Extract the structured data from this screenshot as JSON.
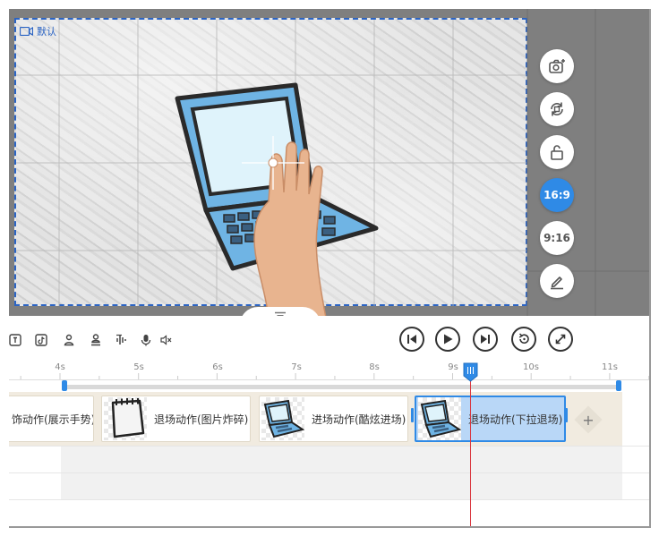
{
  "stage": {
    "scene_label": "默认",
    "aspect_options": [
      "16:9",
      "9:16"
    ],
    "active_aspect": "16:9",
    "tools": [
      {
        "name": "screenshot",
        "icon": "camera-plus-icon"
      },
      {
        "name": "rotate",
        "icon": "rotate-icon"
      },
      {
        "name": "lock",
        "icon": "unlock-icon"
      },
      {
        "name": "ratio-16-9",
        "label": "16:9"
      },
      {
        "name": "ratio-9-16",
        "label": "9:16"
      },
      {
        "name": "edit",
        "icon": "pencil-icon"
      }
    ],
    "accent_color": "#2f8ae6"
  },
  "toolbar": {
    "left_icons": [
      "text-frame-icon",
      "tiktok-icon",
      "person-icon",
      "person-stand-icon",
      "voice-wave-icon",
      "microphone-icon",
      "mute-icon"
    ],
    "playback": [
      "skip-back-icon",
      "play-icon",
      "skip-forward-icon",
      "replay-icon",
      "fullscreen-icon"
    ]
  },
  "timeline": {
    "ticks": [
      "4s",
      "5s",
      "6s",
      "7s",
      "8s",
      "9s",
      "10s",
      "11s"
    ],
    "clips": [
      {
        "label": "饰动作(展示手势)",
        "thumb": "none"
      },
      {
        "label": "退场动作(图片炸碎)",
        "thumb": "notepad"
      },
      {
        "label": "进场动作(酷炫进场)",
        "thumb": "laptop"
      },
      {
        "label": "退场动作(下拉退场)",
        "thumb": "laptop",
        "selected": true
      }
    ],
    "add_label": "+",
    "playhead_color": "#d9363e"
  }
}
